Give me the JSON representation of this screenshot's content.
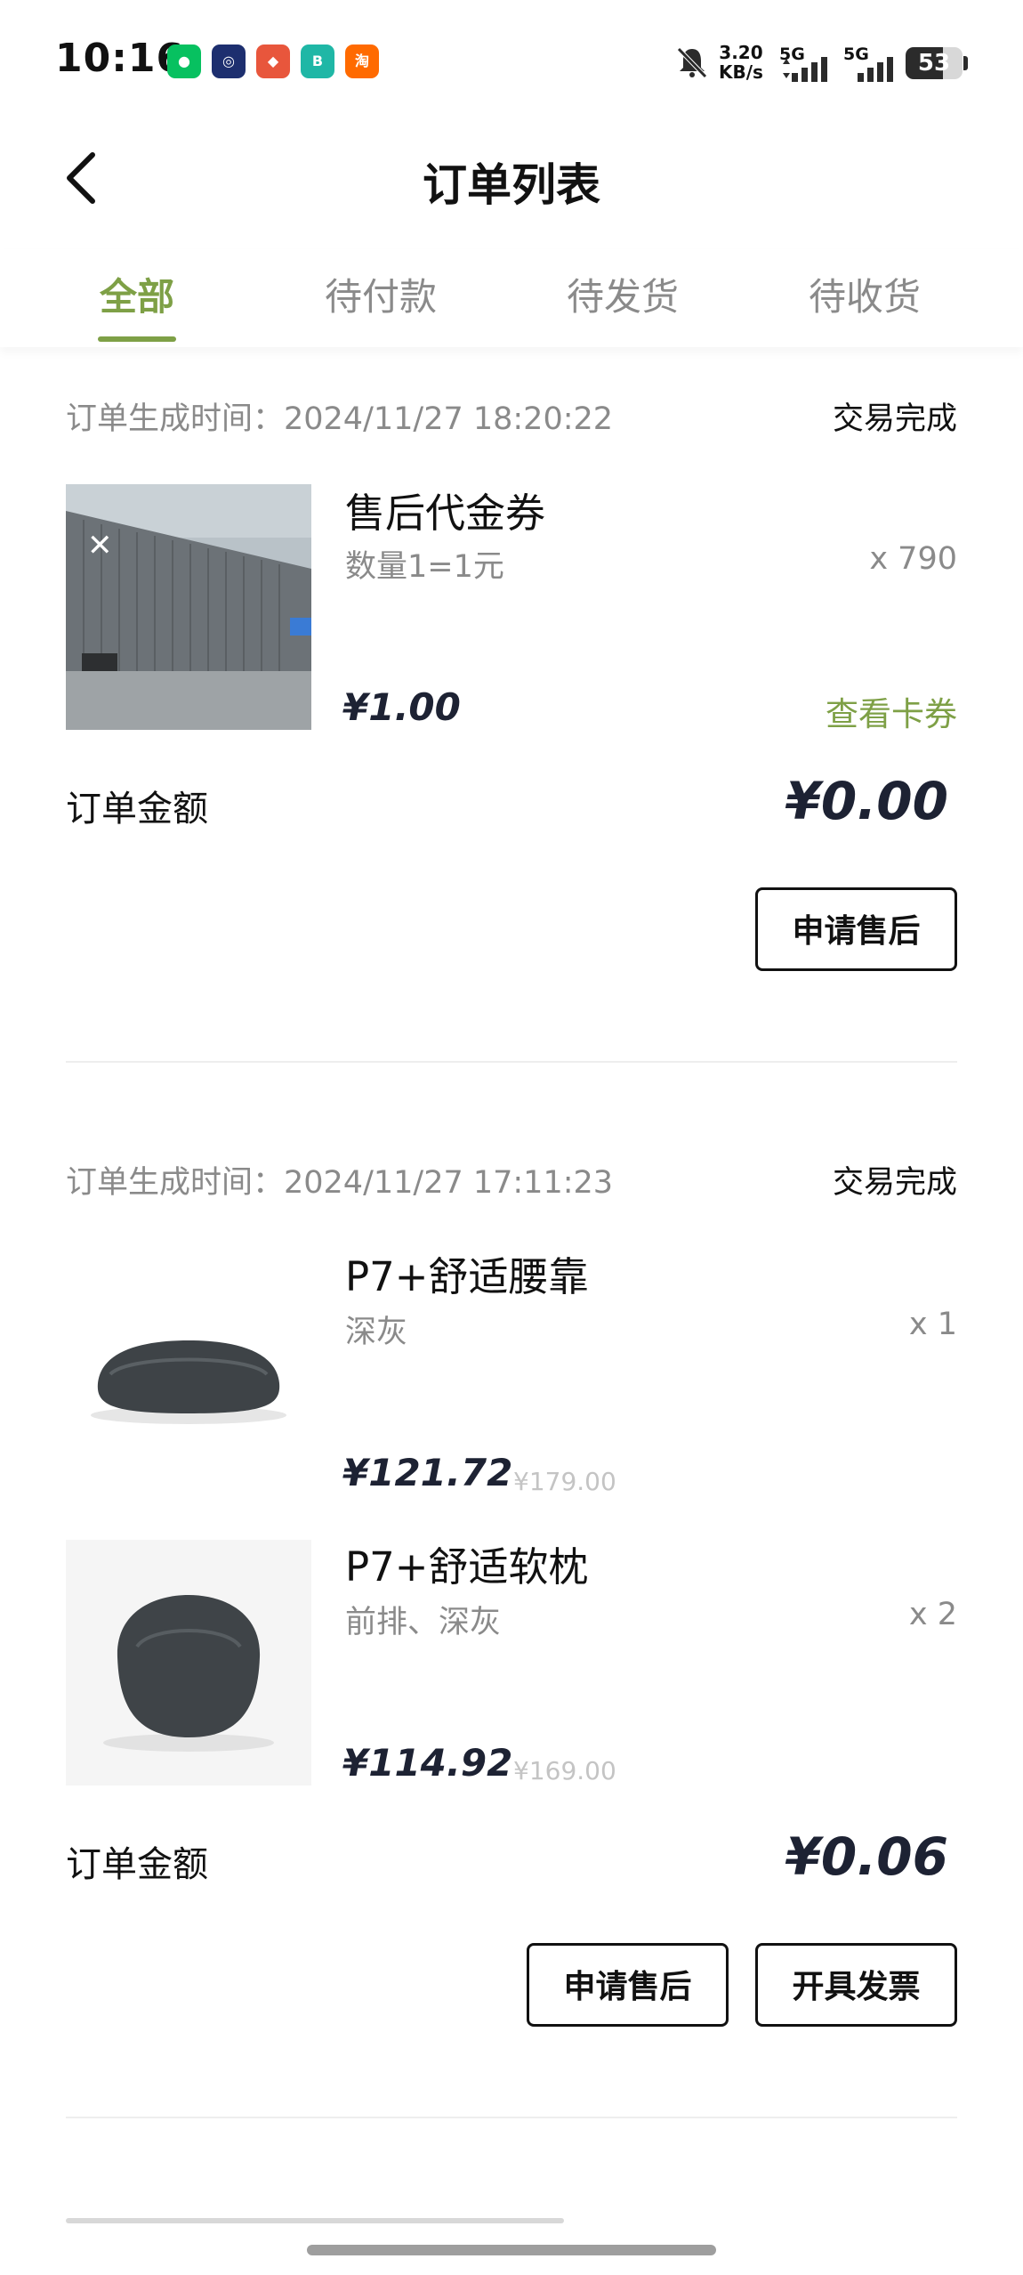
{
  "status_bar": {
    "time": "10:16",
    "net_speed": "3.20",
    "net_unit": "KB/s",
    "sig1": "5G",
    "sig2": "5G",
    "battery": "53",
    "apps": [
      {
        "name": "wechat-icon",
        "color": "#07c160",
        "glyph": "●"
      },
      {
        "name": "chat-app-icon",
        "color": "#1d2f6f",
        "glyph": "◎"
      },
      {
        "name": "promo-app-icon",
        "color": "#e8563c",
        "glyph": "◆"
      },
      {
        "name": "boss-app-icon",
        "color": "#1fb7a6",
        "glyph": "B"
      },
      {
        "name": "taobao-icon",
        "color": "#ff6a00",
        "glyph": "淘"
      }
    ]
  },
  "header": {
    "title": "订单列表"
  },
  "tabs": [
    {
      "label": "全部",
      "active": true
    },
    {
      "label": "待付款",
      "active": false
    },
    {
      "label": "待发货",
      "active": false
    },
    {
      "label": "待收货",
      "active": false
    }
  ],
  "orders": [
    {
      "time_label": "订单生成时间：2024/11/27 18:20:22",
      "status": "交易完成",
      "items": [
        {
          "name": "售后代金券",
          "spec": "数量1=1元",
          "qty": "x 790",
          "price": "¥1.00",
          "link": "查看卡券"
        }
      ],
      "amount_label": "订单金额",
      "amount": "¥0.00",
      "buttons": [
        "申请售后"
      ]
    },
    {
      "time_label": "订单生成时间：2024/11/27 17:11:23",
      "status": "交易完成",
      "items": [
        {
          "name": "P7+舒适腰靠",
          "spec": "深灰",
          "qty": "x 1",
          "price": "¥121.72",
          "orig_price": "¥179.00"
        },
        {
          "name": "P7+舒适软枕",
          "spec": "前排、深灰",
          "qty": "x 2",
          "price": "¥114.92",
          "orig_price": "¥169.00"
        }
      ],
      "amount_label": "订单金额",
      "amount": "¥0.06",
      "buttons": [
        "申请售后",
        "开具发票"
      ]
    }
  ],
  "colors": {
    "accent": "#7ea046",
    "price": "#1d2233",
    "muted": "#8a8a8a"
  }
}
